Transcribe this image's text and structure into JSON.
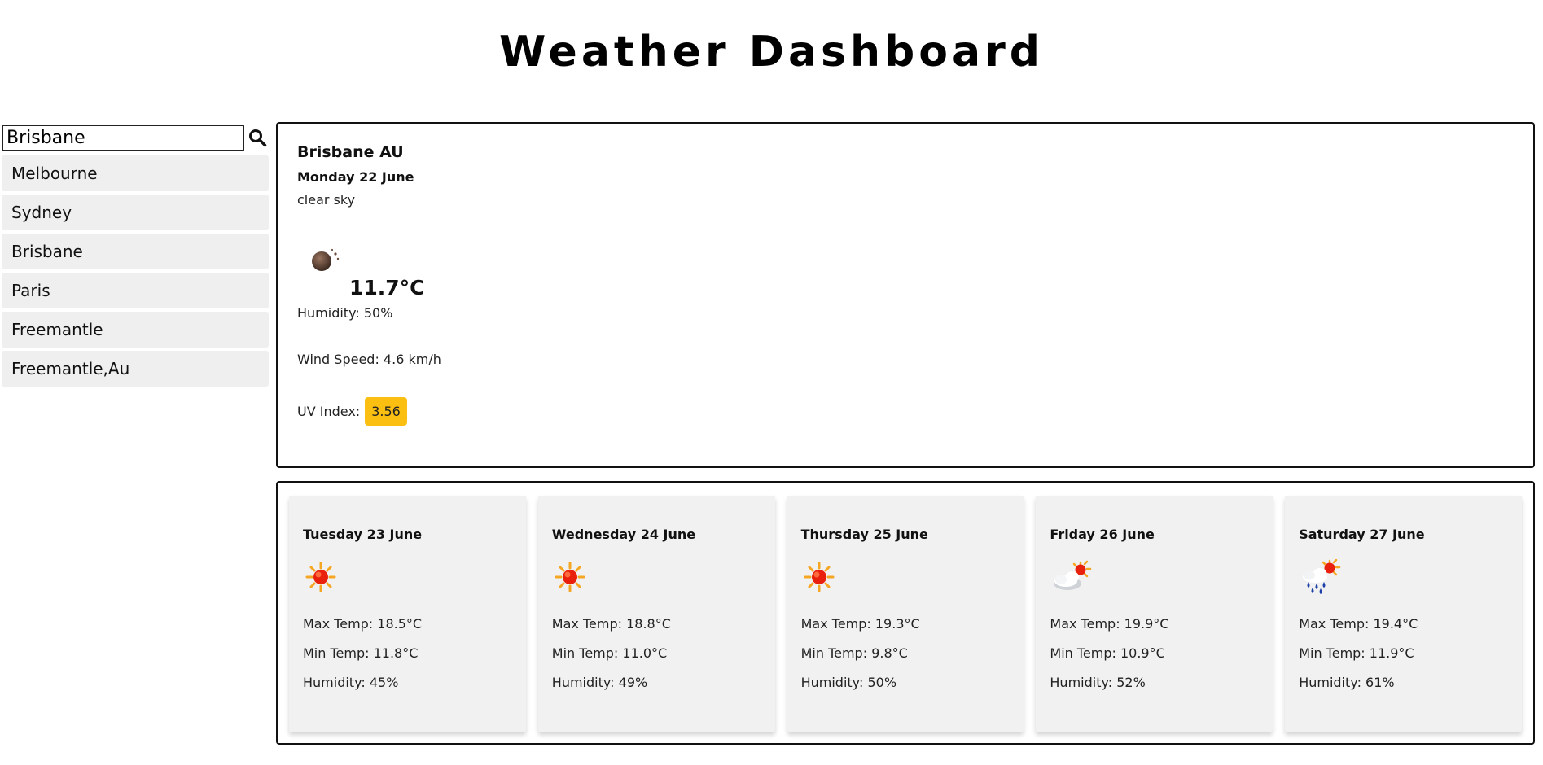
{
  "header": {
    "title": "Weather Dashboard"
  },
  "search": {
    "value": "Brisbane",
    "icon": "search-icon"
  },
  "history": [
    {
      "label": "Melbourne"
    },
    {
      "label": "Sydney"
    },
    {
      "label": "Brisbane"
    },
    {
      "label": "Paris"
    },
    {
      "label": "Freemantle"
    },
    {
      "label": "Freemantle,Au"
    }
  ],
  "current": {
    "city": "Brisbane AU",
    "date": "Monday 22 June",
    "description": "clear sky",
    "icon": "clear-night-icon",
    "temp": "11.7°C",
    "humidity": "Humidity: 50%",
    "wind": "Wind Speed: 4.6 km/h",
    "uv_label": "UV Index:",
    "uv_value": "3.56",
    "uv_color": "#fbbf12"
  },
  "forecast": [
    {
      "date": "Tuesday 23 June",
      "icon": "sun-icon",
      "max": "Max Temp: 18.5°C",
      "min": "Min Temp: 11.8°C",
      "humidity": "Humidity: 45%"
    },
    {
      "date": "Wednesday 24 June",
      "icon": "sun-icon",
      "max": "Max Temp: 18.8°C",
      "min": "Min Temp: 11.0°C",
      "humidity": "Humidity: 49%"
    },
    {
      "date": "Thursday 25 June",
      "icon": "sun-icon",
      "max": "Max Temp: 19.3°C",
      "min": "Min Temp: 9.8°C",
      "humidity": "Humidity: 50%"
    },
    {
      "date": "Friday 26 June",
      "icon": "partly-cloudy-icon",
      "max": "Max Temp: 19.9°C",
      "min": "Min Temp: 10.9°C",
      "humidity": "Humidity: 52%"
    },
    {
      "date": "Saturday 27 June",
      "icon": "rain-sun-icon",
      "max": "Max Temp: 19.4°C",
      "min": "Min Temp: 11.9°C",
      "humidity": "Humidity: 61%"
    }
  ]
}
